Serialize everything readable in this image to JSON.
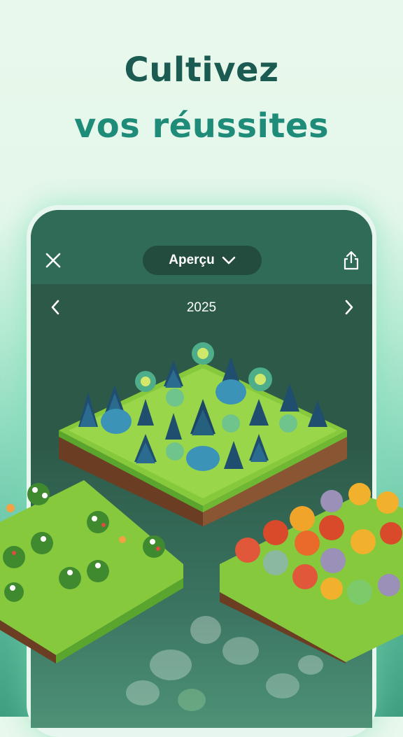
{
  "headline": {
    "line1": "Cultivez",
    "line2": "vos réussites"
  },
  "topbar": {
    "view_label": "Aperçu"
  },
  "navigation": {
    "year": "2025"
  },
  "icons": {
    "close": "close-icon",
    "dropdown": "chevron-down-icon",
    "share": "share-icon",
    "previous": "chevron-left-icon",
    "next": "chevron-right-icon"
  },
  "colors": {
    "headline_dark": "#1b5b52",
    "headline_accent": "#1f8c79",
    "screen_bg": "#2c5848",
    "topbar_bg": "#2f6b57",
    "dropdown_bg": "#244c3e"
  }
}
